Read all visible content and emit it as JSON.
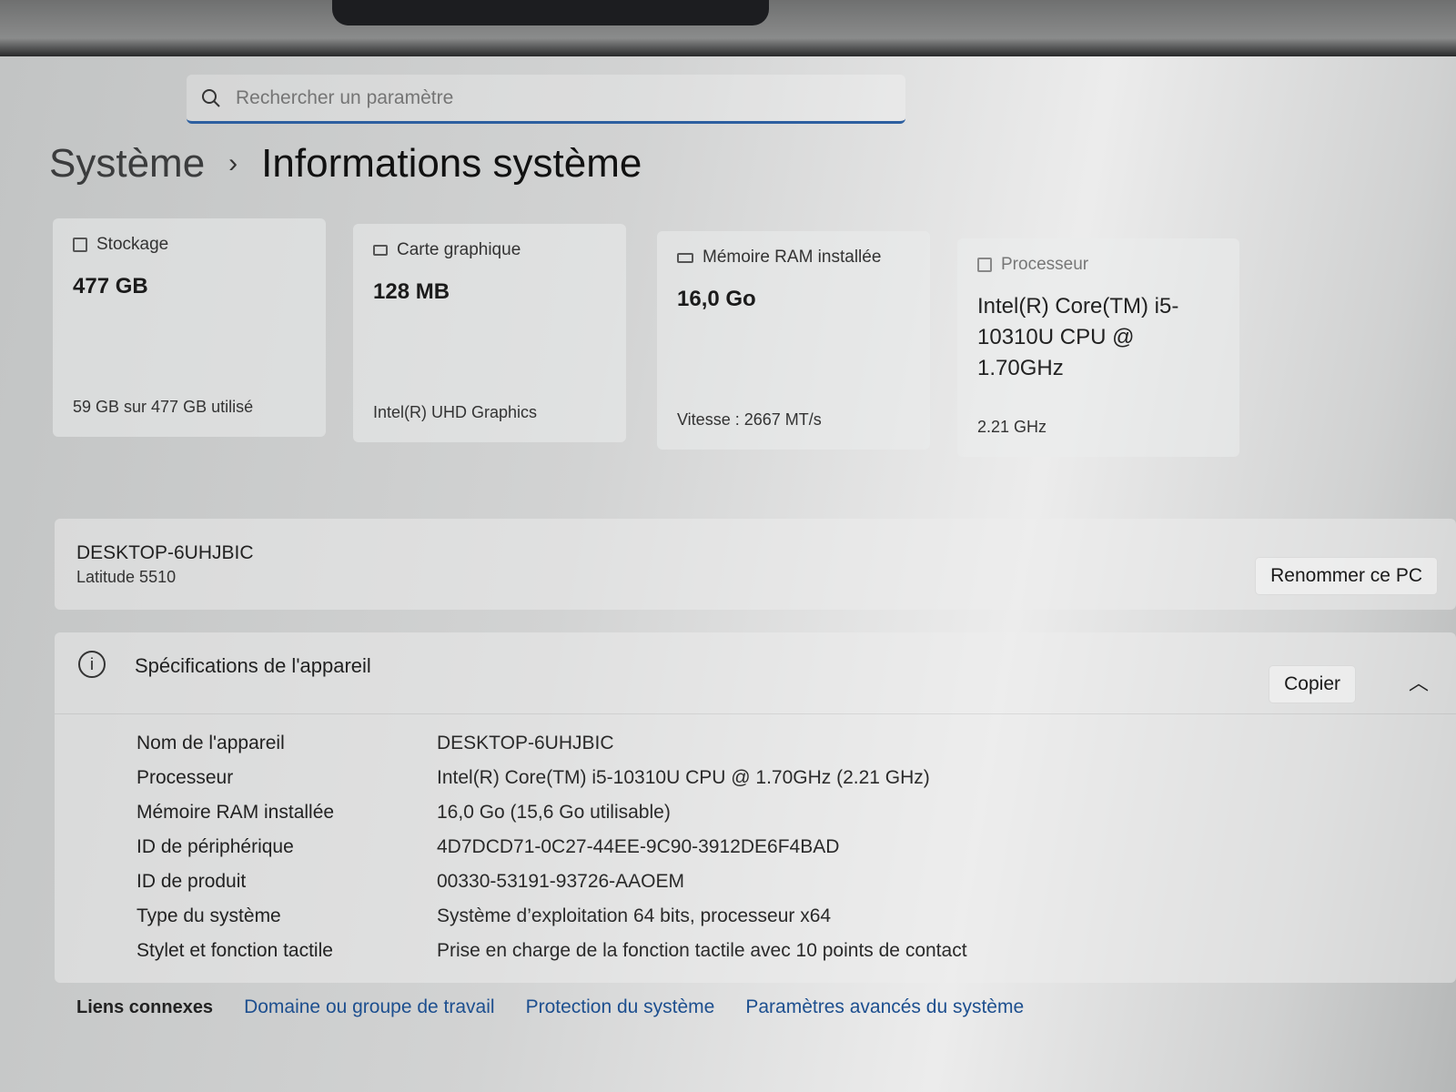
{
  "search": {
    "placeholder": "Rechercher un paramètre"
  },
  "breadcrumb": {
    "parent": "Système",
    "current": "Informations système"
  },
  "cards": [
    {
      "title": "Stockage",
      "value": "477 GB",
      "sub": "59 GB sur 477 GB utilisé",
      "icon": "storage-icon"
    },
    {
      "title": "Carte graphique",
      "value": "128 MB",
      "sub": "Intel(R) UHD Graphics",
      "icon": "gpu-icon"
    },
    {
      "title": "Mémoire RAM installée",
      "value": "16,0 Go",
      "sub": "Vitesse : 2667 MT/s",
      "icon": "ram-icon"
    },
    {
      "title": "Processeur",
      "value": "Intel(R) Core(TM) i5-10310U CPU @ 1.70GHz",
      "sub": "2.21 GHz",
      "icon": "cpu-icon"
    }
  ],
  "device": {
    "name": "DESKTOP-6UHJBIC",
    "model": "Latitude 5510",
    "rename_label": "Renommer ce PC"
  },
  "specs": {
    "title": "Spécifications de l'appareil",
    "copy_label": "Copier",
    "rows": [
      {
        "k": "Nom de l'appareil",
        "v": "DESKTOP-6UHJBIC"
      },
      {
        "k": "Processeur",
        "v": "Intel(R) Core(TM) i5-10310U CPU @ 1.70GHz (2.21 GHz)"
      },
      {
        "k": "Mémoire RAM installée",
        "v": "16,0 Go (15,6 Go utilisable)"
      },
      {
        "k": "ID de périphérique",
        "v": "4D7DCD71-0C27-44EE-9C90-3912DE6F4BAD"
      },
      {
        "k": "ID de produit",
        "v": "00330-53191-93726-AAOEM"
      },
      {
        "k": "Type du système",
        "v": "Système d’exploitation 64 bits, processeur x64"
      },
      {
        "k": "Stylet et fonction tactile",
        "v": "Prise en charge de la fonction tactile avec 10 points de contact"
      }
    ]
  },
  "links": {
    "label": "Liens connexes",
    "items": [
      "Domaine ou groupe de travail",
      "Protection du système",
      "Paramètres avancés du système"
    ]
  }
}
